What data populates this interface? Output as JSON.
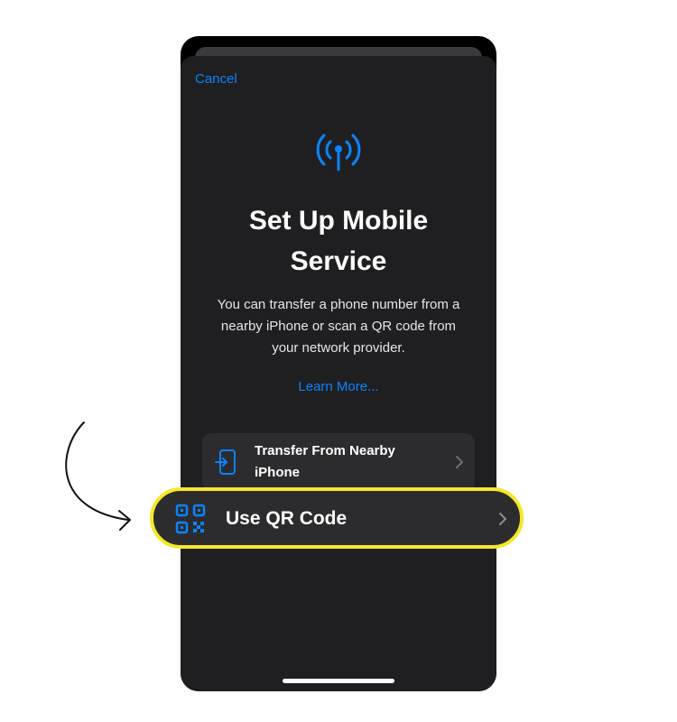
{
  "nav": {
    "cancel_label": "Cancel"
  },
  "header": {
    "title": "Set Up Mobile Service",
    "description": "You can transfer a phone number from a nearby iPhone or scan a QR code from your network provider.",
    "learn_more_label": "Learn More..."
  },
  "options": [
    {
      "label": "Transfer From Nearby iPhone",
      "icon": "transfer-icon"
    },
    {
      "label": "Use QR Code",
      "icon": "qr-code-icon",
      "highlighted": true
    }
  ],
  "colors": {
    "accent": "#0a84ff",
    "highlight_border": "#f5e82a",
    "sheet_background": "#1f1f21",
    "row_background": "#2c2c2e"
  },
  "annotation": {
    "icon": "curved-arrow-icon"
  }
}
